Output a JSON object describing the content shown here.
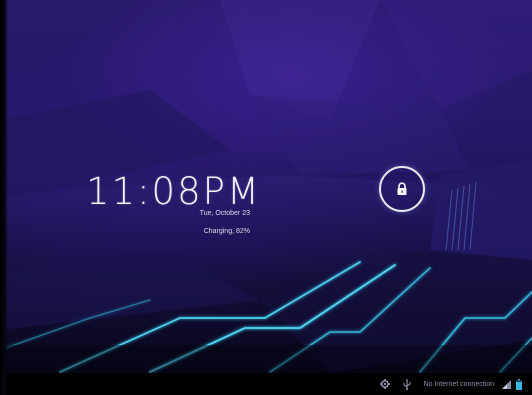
{
  "lockscreen": {
    "time": "11:08PM",
    "date": "Tue, October 23",
    "status": "Charging, 82%"
  },
  "statusbar": {
    "connection_text": "No Internet connection",
    "icons": [
      "settings-icon",
      "usb-icon",
      "signal-icon",
      "battery-icon"
    ]
  },
  "colors": {
    "wallpaper_top": "#2a1a6e",
    "wallpaper_bottom": "#0c0a26",
    "accent_cyan": "#35c8e8",
    "navbar": "#000000"
  }
}
